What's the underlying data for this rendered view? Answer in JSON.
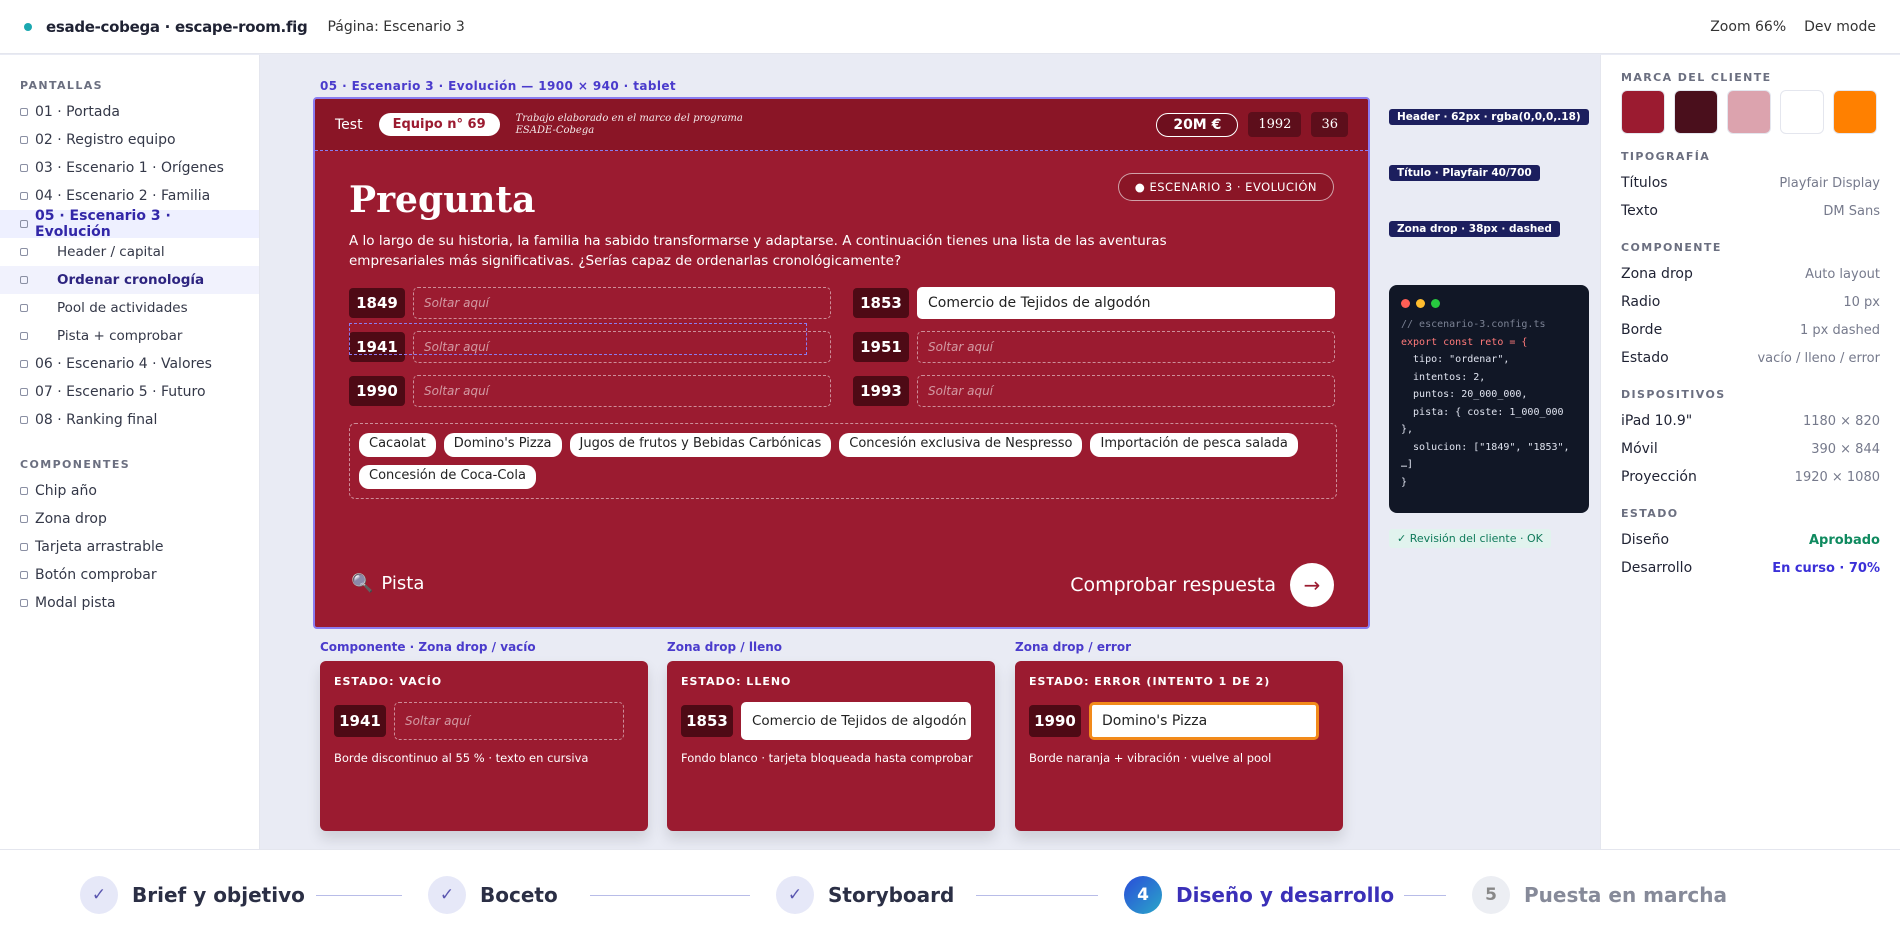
{
  "topbar": {
    "file": "esade-cobega · escape-room.fig",
    "page": "Página: Escenario 3",
    "zoom": "Zoom 66%",
    "mode": "Dev mode"
  },
  "sidebar": {
    "screens_title": "PANTALLAS",
    "screens": [
      "01 · Portada",
      "02 · Registro equipo",
      "03 · Escenario 1 · Orígenes",
      "04 · Escenario 2 · Familia",
      "05 · Escenario 3 · Evolución"
    ],
    "subs": [
      "Header / capital",
      "Ordenar cronología",
      "Pool de actividades",
      "Pista + comprobar"
    ],
    "more": [
      "06 · Escenario 4 · Valores",
      "07 · Escenario 5 · Futuro",
      "08 · Ranking final"
    ],
    "components_title": "COMPONENTES",
    "components": [
      "Chip año",
      "Zona drop",
      "Tarjeta arrastrable",
      "Botón comprobar",
      "Modal pista"
    ]
  },
  "frame": {
    "label": "05 · Escenario 3 · Evolución — 1900 × 940 · tablet",
    "test": "Test",
    "team": "Equipo n° 69",
    "program": "Trabajo elaborado en el marco del programa",
    "program2": "ESADE-Cobega",
    "money": "20M €",
    "year": "1992",
    "count": "36",
    "title": "Pregunta",
    "badge": "● ESCENARIO 3 · EVOLUCIÓN",
    "intro": "A lo largo de su historia, la familia ha sabido transformarse y adaptarse. A continuación tienes una lista de las aventuras empresariales más significativas. ¿Serías capaz de ordenarlas cronológicamente?",
    "placeholder": "Soltar aquí",
    "slots": [
      {
        "year": "1849",
        "value": ""
      },
      {
        "year": "1853",
        "value": "Comercio de Tejidos de algodón"
      },
      {
        "year": "1941",
        "value": ""
      },
      {
        "year": "1951",
        "value": ""
      },
      {
        "year": "1990",
        "value": ""
      },
      {
        "year": "1993",
        "value": ""
      }
    ],
    "chips": [
      "Cacaolat",
      "Domino's Pizza",
      "Jugos de frutos y Bebidas Carbónicas",
      "Concesión exclusiva de Nespresso",
      "Importación de pesca salada",
      "Concesión de Coca-Cola"
    ],
    "hint": "Pista",
    "check": "Comprobar respuesta"
  },
  "notes": {
    "header": "Header · 62px · rgba(0,0,0,.18)",
    "title": "Título · Playfair 40/700",
    "drop": "Zona drop · 38px · dashed",
    "review": "✓ Revisión del cliente · OK"
  },
  "code": [
    "// escenario-3.config.ts",
    "export const reto = {",
    "  tipo: \"ordenar\",",
    "  intentos: 2,",
    "  puntos: 20_000_000,",
    "  pista: { coste: 1_000_000",
    "},",
    "  solucion: [\"1849\", \"1853\",",
    "…]",
    "}"
  ],
  "cards": [
    {
      "label": "Componente · Zona drop / vacío",
      "state": "ESTADO: VACÍO",
      "year": "1941",
      "value": "Soltar aquí",
      "desc": "Borde discontinuo al 55 % · texto en cursiva"
    },
    {
      "label": "Zona drop / lleno",
      "state": "ESTADO: LLENO",
      "year": "1853",
      "value": "Comercio de Tejidos de algodón",
      "desc": "Fondo blanco · tarjeta bloqueada hasta comprobar"
    },
    {
      "label": "Zona drop / error",
      "state": "ESTADO: ERROR (INTENTO 1 DE 2)",
      "year": "1990",
      "value": "Domino's Pizza",
      "desc": "Borde naranja + vibración · vuelve al pool"
    }
  ],
  "panel": {
    "brand_title": "MARCA DEL CLIENTE",
    "swatches": [
      "#9b1b30",
      "#4a0f1c",
      "#dca3ae",
      "#ffffff",
      "#ff8000"
    ],
    "typo_title": "TIPOGRAFÍA",
    "typo": [
      [
        "Títulos",
        "Playfair Display"
      ],
      [
        "Texto",
        "DM Sans"
      ]
    ],
    "comp_title": "COMPONENTE",
    "comp": [
      [
        "Zona drop",
        "Auto layout"
      ],
      [
        "Radio",
        "10 px"
      ],
      [
        "Borde",
        "1 px dashed"
      ],
      [
        "Estado",
        "vacío / lleno / error"
      ]
    ],
    "dev_title": "DISPOSITIVOS",
    "dev": [
      [
        "iPad 10.9\"",
        "1180 × 820"
      ],
      [
        "Móvil",
        "390 × 844"
      ],
      [
        "Proyección",
        "1920 × 1080"
      ]
    ],
    "state_title": "ESTADO",
    "state": [
      [
        "Diseño",
        "Aprobado"
      ],
      [
        "Desarrollo",
        "En curso · 70%"
      ]
    ]
  },
  "steps": [
    {
      "icon": "✓",
      "label": "Brief y objetivo"
    },
    {
      "icon": "✓",
      "label": "Boceto"
    },
    {
      "icon": "✓",
      "label": "Storyboard"
    },
    {
      "icon": "4",
      "label": "Diseño y desarrollo"
    },
    {
      "icon": "5",
      "label": "Puesta en marcha"
    }
  ]
}
